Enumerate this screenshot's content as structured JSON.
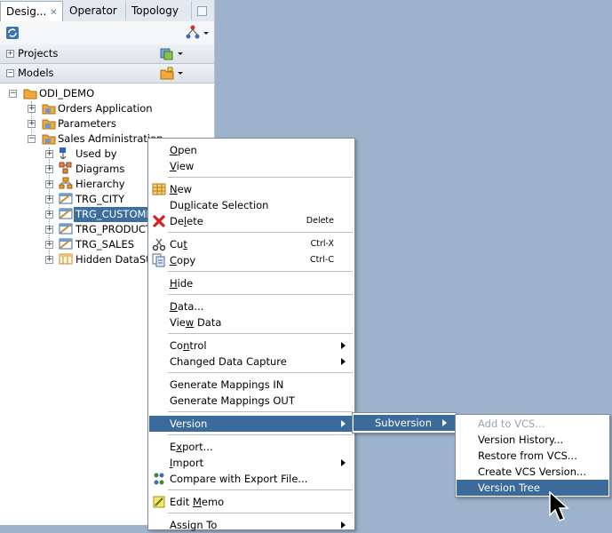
{
  "tabs": [
    {
      "label": "Desig...",
      "active": true
    },
    {
      "label": "Operator",
      "active": false
    },
    {
      "label": "Topology",
      "active": false
    }
  ],
  "accordions": {
    "projects": "Projects",
    "models": "Models"
  },
  "tree": {
    "root": "ODI_DEMO",
    "level1": [
      "Orders Application",
      "Parameters",
      "Sales Administration"
    ],
    "level2": [
      "Used by",
      "Diagrams",
      "Hierarchy",
      "TRG_CITY",
      "TRG_CUSTOME",
      "TRG_PRODUCT",
      "TRG_SALES",
      "Hidden DataSto"
    ],
    "selected": "TRG_CUSTOME"
  },
  "context_menu": {
    "items": [
      {
        "pre": "",
        "ul": "O",
        "post": "pen",
        "shortcut": ""
      },
      {
        "pre": "",
        "ul": "V",
        "post": "iew",
        "shortcut": ""
      },
      {
        "pre": "",
        "ul": "N",
        "post": "ew",
        "shortcut": ""
      },
      {
        "pre": "Du",
        "ul": "p",
        "post": "licate Selection",
        "shortcut": ""
      },
      {
        "pre": "De",
        "ul": "l",
        "post": "ete",
        "shortcut": "Delete"
      },
      {
        "pre": "Cu",
        "ul": "t",
        "post": "",
        "shortcut": "Ctrl-X"
      },
      {
        "pre": "",
        "ul": "C",
        "post": "opy",
        "shortcut": "Ctrl-C"
      },
      {
        "pre": "",
        "ul": "H",
        "post": "ide",
        "shortcut": ""
      },
      {
        "pre": "",
        "ul": "D",
        "post": "ata...",
        "shortcut": ""
      },
      {
        "pre": "Vie",
        "ul": "w",
        "post": " Data",
        "shortcut": ""
      },
      {
        "pre": "Co",
        "ul": "n",
        "post": "trol",
        "shortcut": ""
      },
      {
        "pre": "Changed Data Capture",
        "ul": "",
        "post": "",
        "shortcut": ""
      },
      {
        "pre": "Generate Mappings IN",
        "ul": "",
        "post": "",
        "shortcut": ""
      },
      {
        "pre": "Generate Mappings OUT",
        "ul": "",
        "post": "",
        "shortcut": ""
      },
      {
        "pre": "Version",
        "ul": "",
        "post": "",
        "shortcut": ""
      },
      {
        "pre": "E",
        "ul": "x",
        "post": "port...",
        "shortcut": ""
      },
      {
        "pre": "",
        "ul": "I",
        "post": "mport",
        "shortcut": ""
      },
      {
        "pre": "Compare with Export File...",
        "ul": "",
        "post": "",
        "shortcut": ""
      },
      {
        "pre": "Edit ",
        "ul": "M",
        "post": "emo",
        "shortcut": ""
      },
      {
        "pre": "Assign To",
        "ul": "",
        "post": "",
        "shortcut": ""
      }
    ]
  },
  "version_submenu": {
    "items": [
      "Subversion"
    ]
  },
  "subversion_submenu": {
    "items": [
      "Add to VCS...",
      "Version History...",
      "Restore from VCS...",
      "Create VCS Version...",
      "Version Tree"
    ]
  },
  "colors": {
    "accent": "#3b6b9b",
    "background": "#9db3cc"
  }
}
